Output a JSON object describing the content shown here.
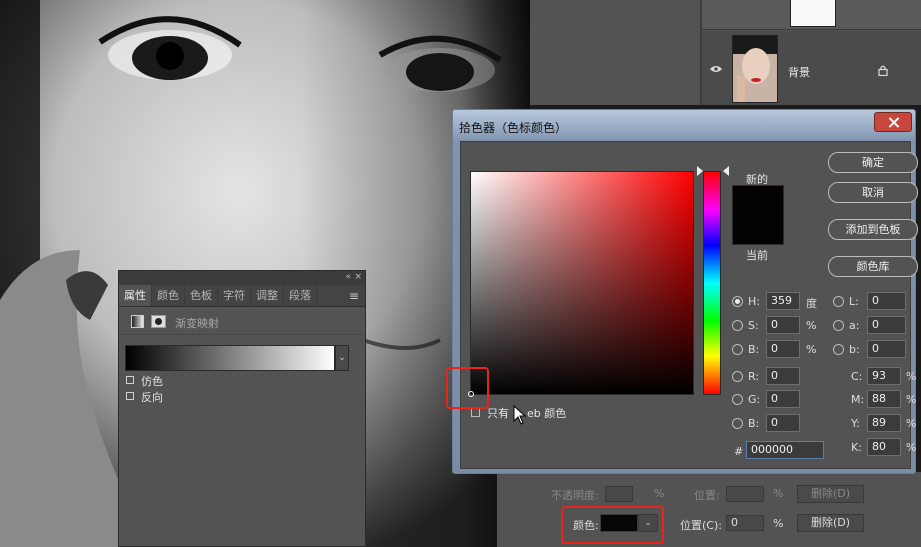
{
  "layers": {
    "layer_name": "背景"
  },
  "properties_panel": {
    "tabs": [
      "属性",
      "颜色",
      "色板",
      "字符",
      "调整",
      "段落"
    ],
    "active_tab": "属性",
    "title": "渐变映射",
    "collapse_glyph": "«",
    "close_glyph": "×",
    "menu_glyph": "≡",
    "dropdown_glyph": "⌄",
    "options": [
      "仿色",
      "反向"
    ]
  },
  "gradient_editor": {
    "opacity_label": "不透明度:",
    "color_label": "颜色:",
    "location_label_1": "位置:",
    "location_label_2": "位置(C):",
    "location_value": "0",
    "percent": "%",
    "delete_label": "删除(D)"
  },
  "color_picker": {
    "title": "拾色器（色标颜色）",
    "new_label": "新的",
    "current_label": "当前",
    "swatch_color": "#040102",
    "buttons": [
      "确定",
      "取消",
      "添加到色板",
      "颜色库"
    ],
    "web_only_label_prefix": "只有",
    "web_only_label_rest": "eb  颜色",
    "hsb": [
      {
        "label": "H:",
        "value": "359",
        "unit": "度",
        "selected": true
      },
      {
        "label": "S:",
        "value": "0",
        "unit": "%",
        "selected": false
      },
      {
        "label": "B:",
        "value": "0",
        "unit": "%",
        "selected": false
      }
    ],
    "rgb": [
      {
        "label": "R:",
        "value": "0"
      },
      {
        "label": "G:",
        "value": "0"
      },
      {
        "label": "B:",
        "value": "0"
      }
    ],
    "lab": [
      {
        "label": "L:",
        "value": "0"
      },
      {
        "label": "a:",
        "value": "0"
      },
      {
        "label": "b:",
        "value": "0"
      }
    ],
    "cmyk": [
      {
        "label": "C:",
        "value": "93",
        "unit": "%"
      },
      {
        "label": "M:",
        "value": "88",
        "unit": "%"
      },
      {
        "label": "Y:",
        "value": "89",
        "unit": "%"
      },
      {
        "label": "K:",
        "value": "80",
        "unit": "%"
      }
    ],
    "hex_label": "#",
    "hex_value": "000000"
  }
}
